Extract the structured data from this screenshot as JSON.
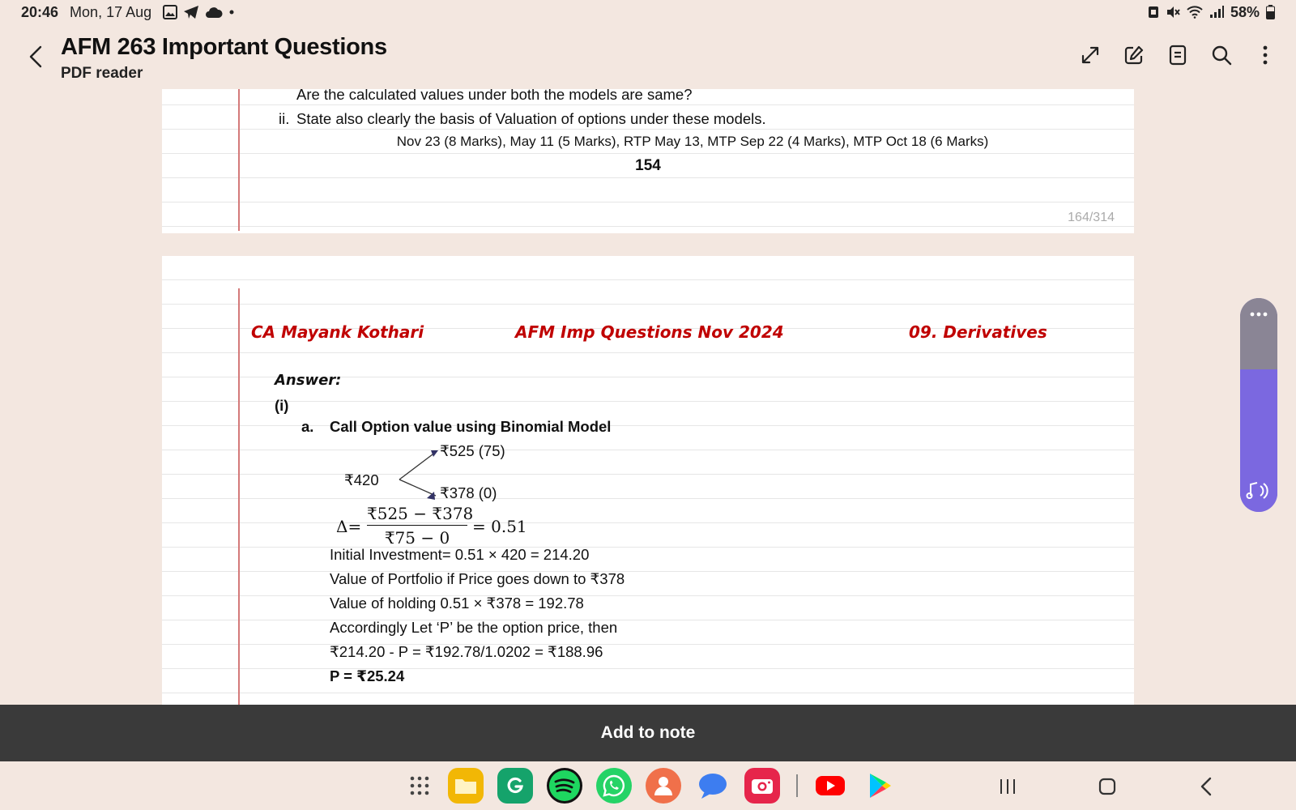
{
  "status_bar": {
    "time": "20:46",
    "date": "Mon, 17 Aug",
    "battery": "58%",
    "icons": [
      "gallery-icon",
      "telegram-icon",
      "cloud-icon",
      "dot-icon",
      "sim-icon",
      "mute-icon",
      "wifi-icon",
      "signal-icon",
      "battery-icon"
    ]
  },
  "app_bar": {
    "title": "AFM 263 Important Questions",
    "subtitle": "PDF reader",
    "actions": [
      "expand-icon",
      "edit-icon",
      "document-icon",
      "search-icon",
      "more-icon"
    ]
  },
  "page1": {
    "line1": "Are the calculated values under both the models are same?",
    "line2_num": "ii.",
    "line2": "State also clearly the basis of Valuation of options under these models.",
    "source": "Nov 23 (8 Marks), May 11 (5 Marks), RTP May 13, MTP Sep 22 (4 Marks), MTP Oct 18 (6 Marks)",
    "page_number": "154",
    "page_count": "164/314"
  },
  "page2": {
    "header_left": "CA Mayank Kothari",
    "header_center": "AFM Imp Questions Nov 2024",
    "header_right": "09. Derivatives",
    "answer_label": "Answer:",
    "part": "(i)",
    "sub_label": "a.",
    "sub_title": "Call Option value using Binomial Model",
    "tree": {
      "root": "₹420",
      "up": "₹525 (75)",
      "down": "₹378 (0)"
    },
    "formula": {
      "lhs": "Δ=",
      "numerator": "₹525 − ₹378",
      "denominator": "₹75 − 0",
      "result": "= 0.51"
    },
    "lines": [
      "Initial Investment= 0.51 × 420 = 214.20",
      "Value of Portfolio if Price goes down to ₹378",
      "Value of holding 0.51 × ₹378 = 192.78",
      "Accordingly Let ‘P’ be the option price, then",
      "₹214.20 - P = ₹192.78/1.0202 = ₹188.96"
    ],
    "final": "P = ₹25.24"
  },
  "note_bar": {
    "label": "Add to note"
  },
  "dock": {
    "apps": [
      "app-drawer-icon",
      "files-icon",
      "grammarly-icon",
      "spotify-icon",
      "whatsapp-icon",
      "contacts-icon",
      "messages-icon",
      "camera-icon",
      "youtube-icon",
      "play-store-icon"
    ],
    "nav": [
      "recents-icon",
      "home-icon",
      "back-icon"
    ]
  },
  "colors": {
    "background": "#f3e7e0",
    "accent_red": "#c00000",
    "note_bar": "#3a3a3a",
    "panel_purple": "#7b68e0"
  }
}
